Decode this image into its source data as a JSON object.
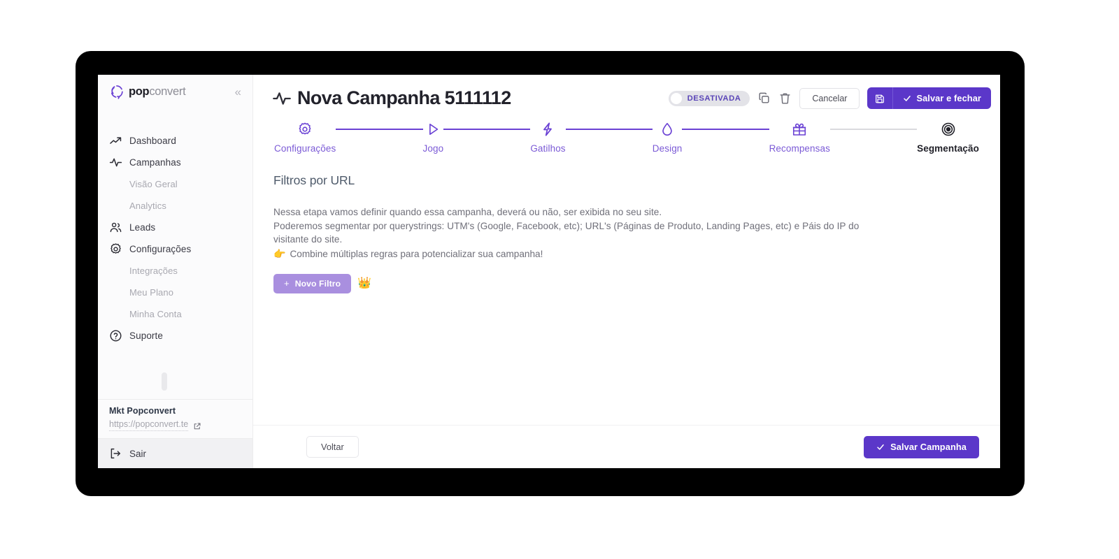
{
  "brand": {
    "bold": "pop",
    "light": "convert",
    "collapse_icon": "«"
  },
  "sidebar": {
    "items": [
      {
        "label": "Dashboard",
        "icon": "trending-up-icon",
        "type": "main"
      },
      {
        "label": "Campanhas",
        "icon": "pulse-icon",
        "type": "main"
      },
      {
        "label": "Visão Geral",
        "type": "sub"
      },
      {
        "label": "Analytics",
        "type": "sub"
      },
      {
        "label": "Leads",
        "icon": "people-icon",
        "type": "main"
      },
      {
        "label": "Configurações",
        "icon": "gear-icon",
        "type": "main"
      },
      {
        "label": "Integrações",
        "type": "sub"
      },
      {
        "label": "Meu Plano",
        "type": "sub"
      },
      {
        "label": "Minha Conta",
        "type": "sub"
      },
      {
        "label": "Suporte",
        "icon": "question-circle-icon",
        "type": "main"
      }
    ],
    "flags": [
      {
        "name": "flag-brazil",
        "active": true
      },
      {
        "name": "flag-usa",
        "active": false
      },
      {
        "name": "flag-spain",
        "active": false
      }
    ],
    "account_name": "Mkt Popconvert",
    "account_url": "https://popconvert.te",
    "logout_label": "Sair"
  },
  "header": {
    "title": "Nova Campanha 5111112",
    "status_label": "DESATIVADA",
    "cancel_label": "Cancelar",
    "save_close_label": "Salvar e fechar"
  },
  "stepper": {
    "steps": [
      {
        "label": "Configurações",
        "icon": "gear-icon",
        "state": "done"
      },
      {
        "label": "Jogo",
        "icon": "play-icon",
        "state": "done"
      },
      {
        "label": "Gatilhos",
        "icon": "bolt-icon",
        "state": "done"
      },
      {
        "label": "Design",
        "icon": "droplet-icon",
        "state": "done"
      },
      {
        "label": "Recompensas",
        "icon": "gift-icon",
        "state": "done"
      },
      {
        "label": "Segmentação",
        "icon": "target-icon",
        "state": "current"
      }
    ]
  },
  "content": {
    "section_title": "Filtros por URL",
    "desc_line1": "Nessa etapa vamos definir quando essa campanha, deverá ou não, ser exibida no seu site.",
    "desc_line2": "Poderemos segmentar por querystrings: UTM's (Google, Facebook, etc); URL's (Páginas de Produto, Landing Pages, etc) e Páis do IP do",
    "desc_line3": "visitante do site.",
    "highlight_emoji": "👉",
    "highlight_text": "Combine múltiplas regras para potencializar sua campanha!",
    "new_filter_plus": "+",
    "new_filter_label": "Novo Filtro",
    "crown_emoji": "👑"
  },
  "footer": {
    "back_label": "Voltar",
    "save_campaign_label": "Salvar Campanha"
  },
  "colors": {
    "primary": "#5b37c9",
    "step_done": "#6a41d4",
    "step_muted": "#dadade",
    "new_filter_bg": "#a98fdf",
    "status_text": "#5b46b8"
  }
}
